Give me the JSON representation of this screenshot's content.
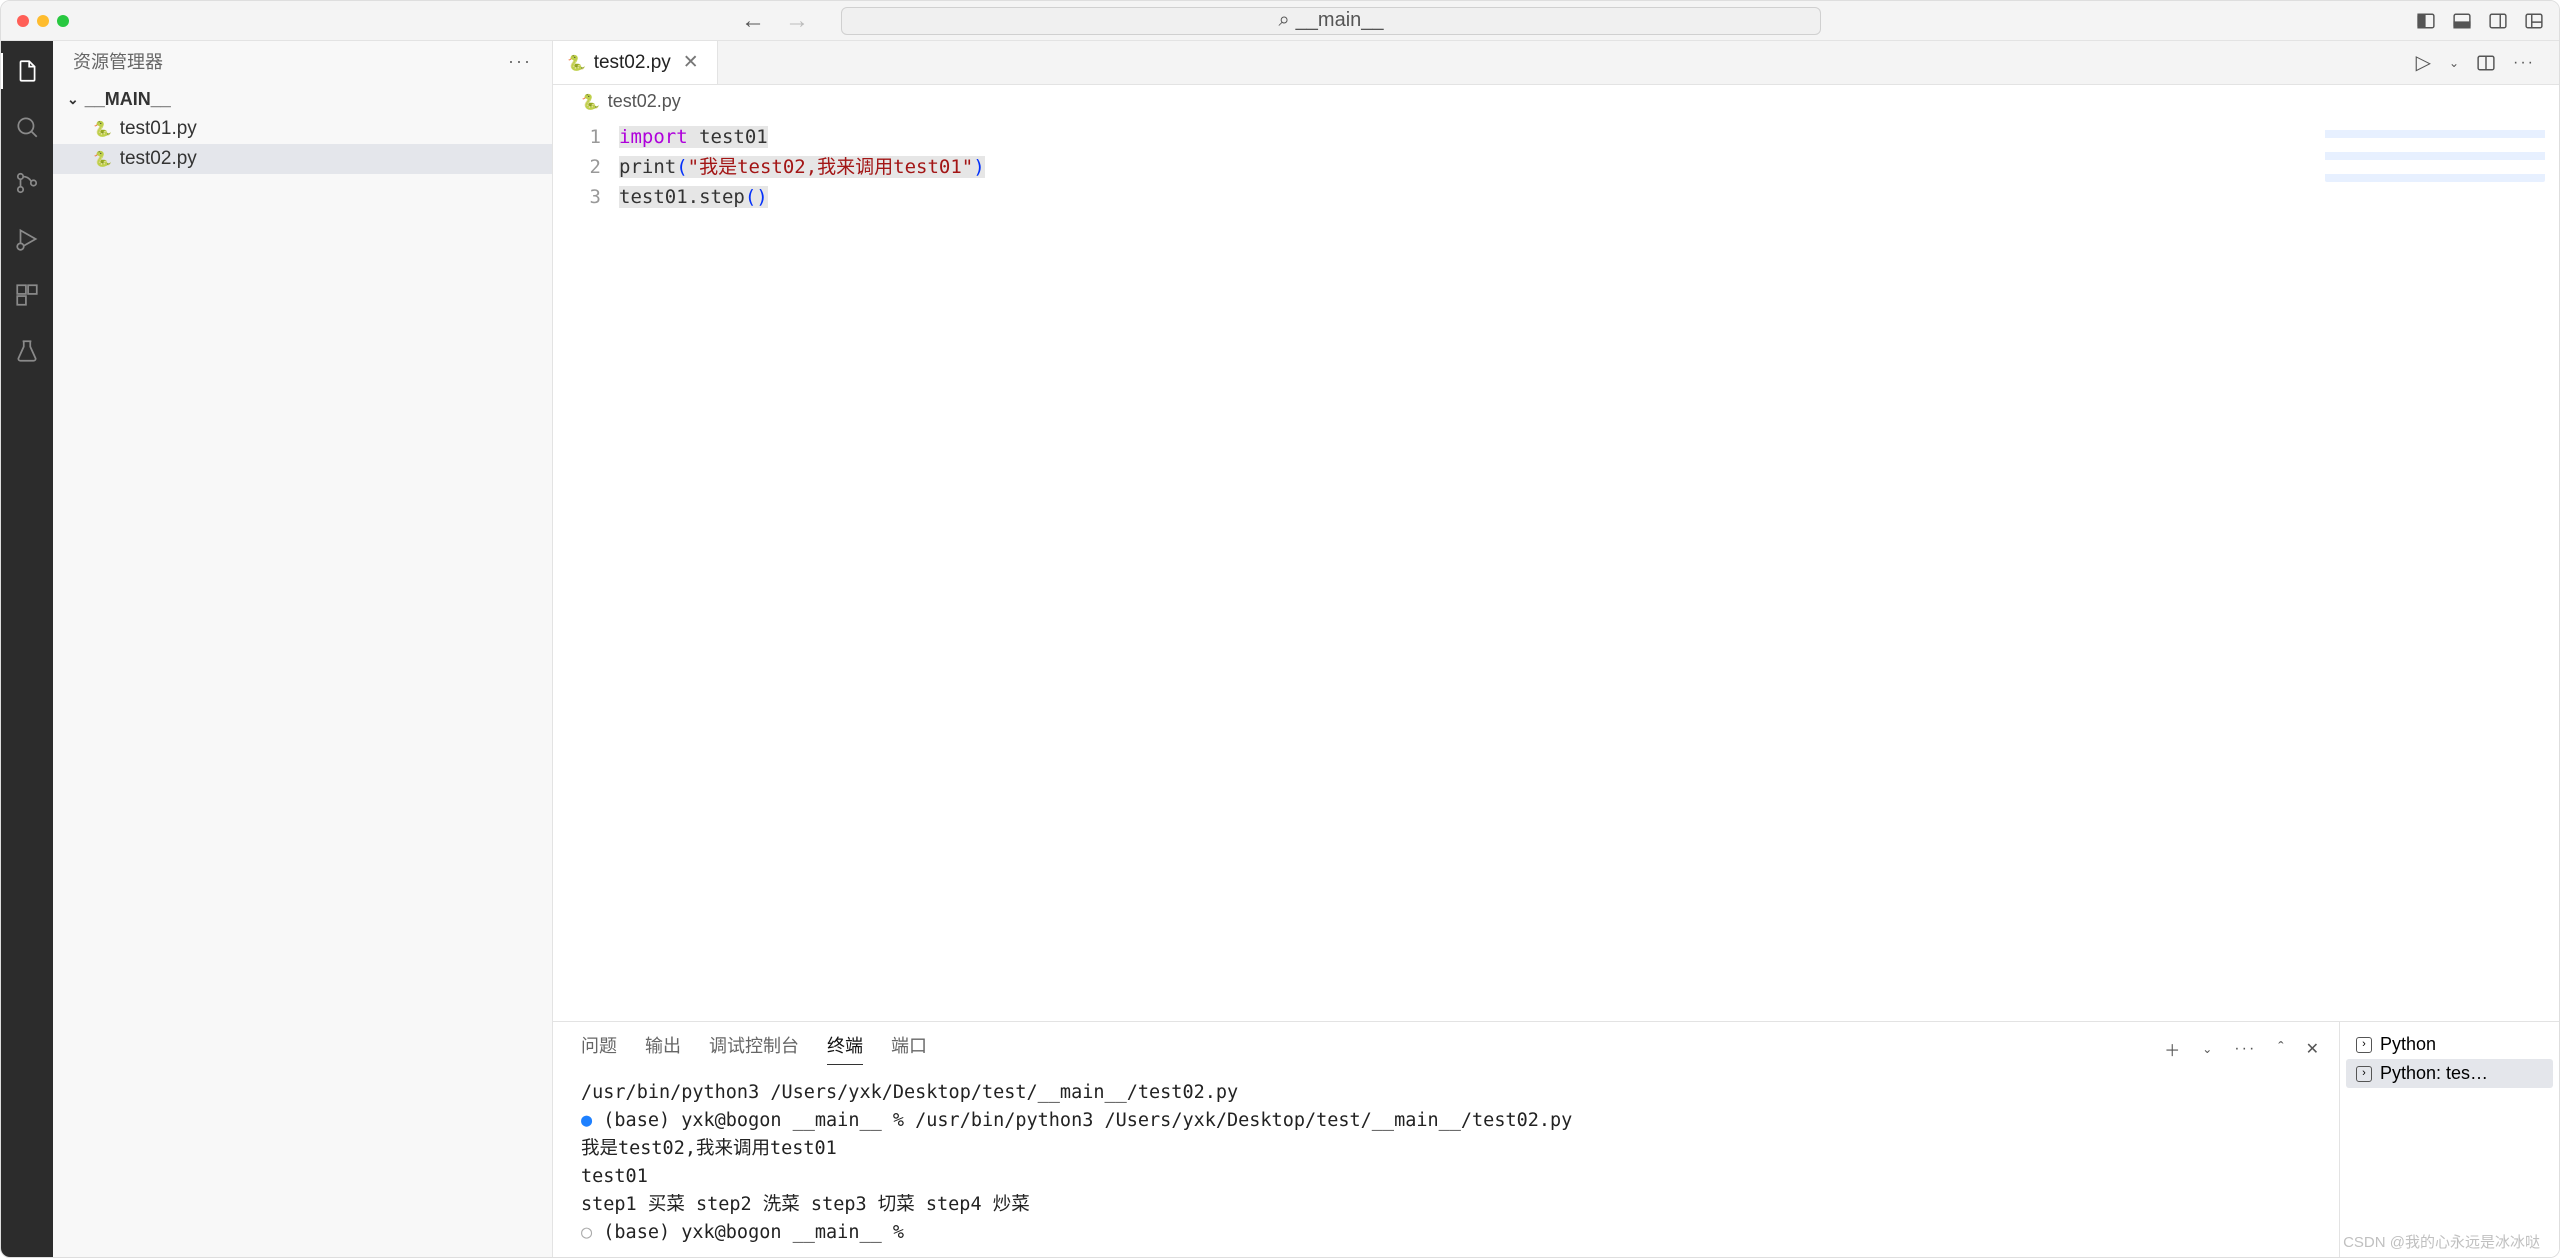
{
  "titlebar": {
    "back_icon": "←",
    "forward_icon": "→",
    "search_text": "__main__",
    "search_icon": "⌕"
  },
  "sidebar": {
    "title": "资源管理器",
    "more": "···",
    "folder": "__MAIN__",
    "files": [
      {
        "name": "test01.py"
      },
      {
        "name": "test02.py"
      }
    ]
  },
  "tabs": {
    "items": [
      {
        "label": "test02.py"
      }
    ],
    "play": "▷",
    "more": "···"
  },
  "breadcrumb": {
    "file": "test02.py"
  },
  "code": {
    "l1a": "import",
    "l1b": " test01",
    "l2a": "print",
    "l2p1": "(",
    "l2str": "\"我是test02,我来调用test01\"",
    "l2p2": ")",
    "l3a": "test01.step",
    "l3p1": "(",
    "l3p2": ")"
  },
  "panel": {
    "tabs": [
      "问题",
      "输出",
      "调试控制台",
      "终端",
      "端口"
    ],
    "active": 3,
    "plus": "＋",
    "more": "···",
    "up": "ˆ",
    "close": "✕",
    "terminal_lines": [
      "/usr/bin/python3 /Users/yxk/Desktop/test/__main__/test02.py",
      "(base) yxk@bogon __main__ % /usr/bin/python3 /Users/yxk/Desktop/test/__main__/test02.py",
      "我是test02,我来调用test01",
      "test01",
      "step1 买菜 step2 洗菜 step3 切菜 step4 炒菜",
      "(base) yxk@bogon __main__ % "
    ],
    "right": [
      {
        "label": "Python"
      },
      {
        "label": "Python: tes…"
      }
    ]
  },
  "watermark": "CSDN @我的心永远是冰冰哒"
}
